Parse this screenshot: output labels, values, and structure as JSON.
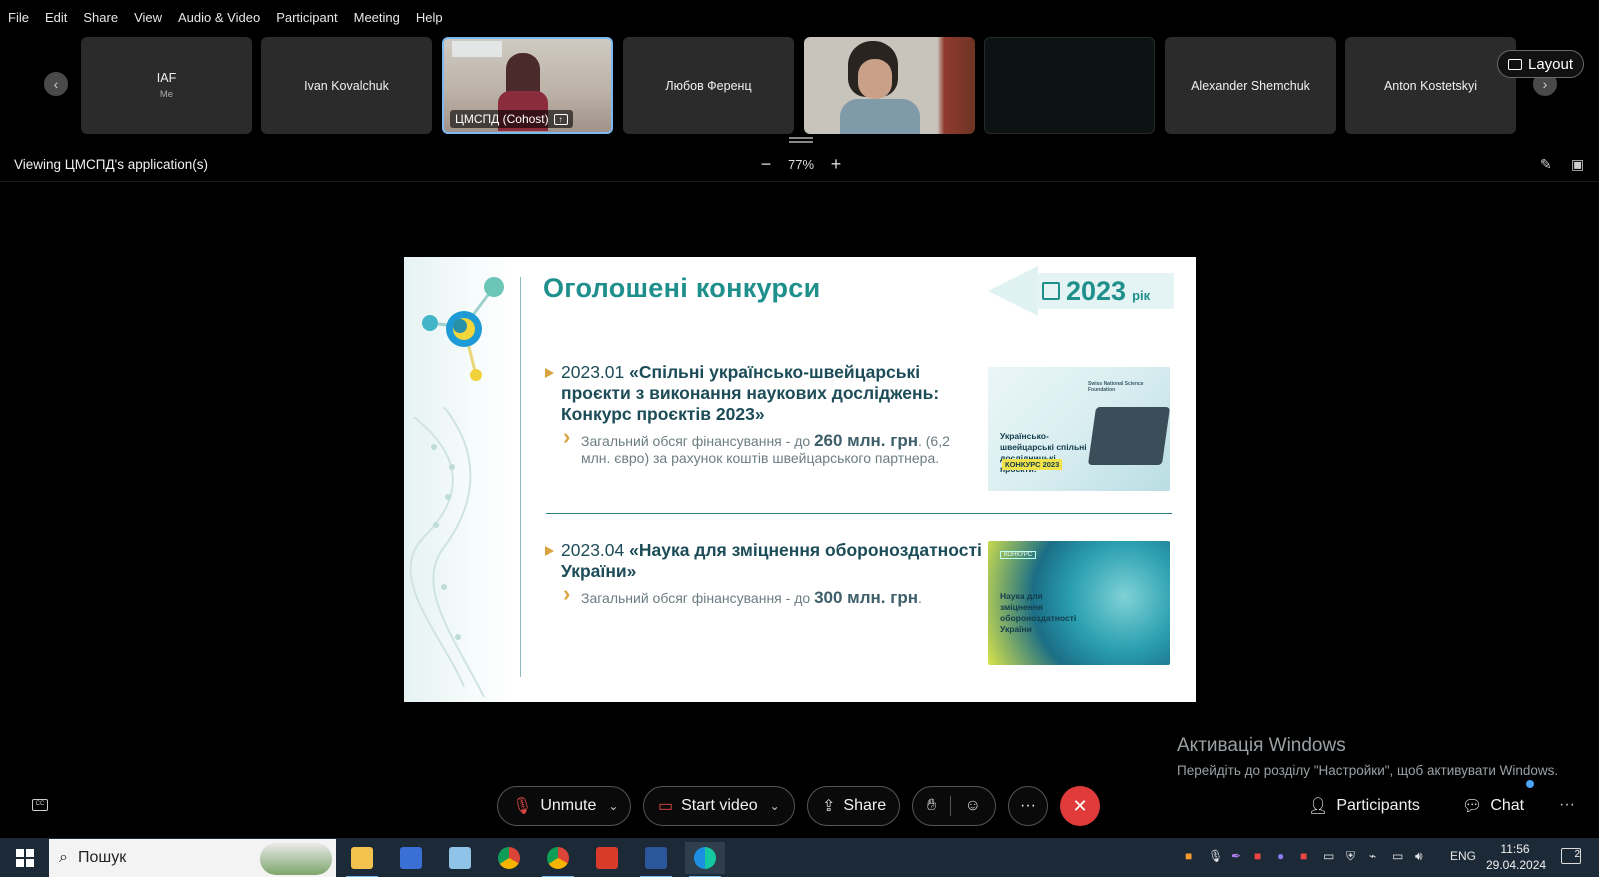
{
  "menu": {
    "items": [
      "File",
      "Edit",
      "Share",
      "View",
      "Audio & Video",
      "Participant",
      "Meeting",
      "Help"
    ]
  },
  "participants": {
    "tiles": [
      {
        "name": "IAF",
        "subtitle": "Me"
      },
      {
        "name": "Ivan Kovalchuk",
        "subtitle": ""
      },
      {
        "name": "ЦМСПД (Cohost)",
        "subtitle": ""
      },
      {
        "name": "Любов Ференц",
        "subtitle": ""
      },
      {
        "name": "",
        "subtitle": ""
      },
      {
        "name": "",
        "subtitle": ""
      },
      {
        "name": "Alexander Shemchuk",
        "subtitle": ""
      },
      {
        "name": "Anton Kostetskyi",
        "subtitle": ""
      }
    ],
    "layout_label": "Layout",
    "prev_icon": "chevron-left-icon",
    "next_icon": "chevron-right-icon"
  },
  "viewbar": {
    "viewing_text": "Viewing ЦМСПД's application(s)",
    "zoom_minus": "−",
    "zoom_value": "77%",
    "zoom_plus": "+"
  },
  "slide": {
    "title": "Оголошені конкурси",
    "year": "2023",
    "year_suffix": "рік",
    "item1_code": "2023.01",
    "item1_title": "«Спільні українсько-швейцарські проєкти з виконання наукових досліджень: Конкурс проєктів 2023»",
    "item1_sub_prefix": "Загальний обсяг фінансування - до",
    "item1_sub_amount": "260 млн. грн",
    "item1_sub_rest": ". (6,2 млн. євро) за рахунок коштів швейцарського партнера.",
    "item2_code": "2023.04",
    "item2_title": "«Наука для зміцнення обороноздатності України»",
    "item2_sub_prefix": "Загальний обсяг фінансування - до",
    "item2_sub_amount": "300 млн. грн",
    "item2_sub_rest": ".",
    "thumb1_text": "Українсько-швейцарські спільні дослідницькі проєкти:",
    "thumb1_badge": "КОНКУРС 2023",
    "thumb1_small": "Swiss National Science Foundation",
    "thumb2_text": "Наука для зміцнення обороноздатності України",
    "thumb2_badge": "КОНКУРС"
  },
  "watermark": {
    "line1": "Активація Windows",
    "line2": "Перейдіть до розділу \"Настройки\", щоб активувати Windows."
  },
  "controls": {
    "unmute": "Unmute",
    "start_video": "Start video",
    "share": "Share",
    "participants": "Participants",
    "chat": "Chat",
    "more": "···"
  },
  "taskbar": {
    "search_placeholder": "Пошук",
    "lang": "ENG",
    "time": "11:56",
    "date": "29.04.2024",
    "notifications": "2"
  },
  "colors": {
    "accent_teal": "#1f8f8c",
    "end_red": "#e03a3a",
    "active_tile_border": "#7cb9f0"
  }
}
